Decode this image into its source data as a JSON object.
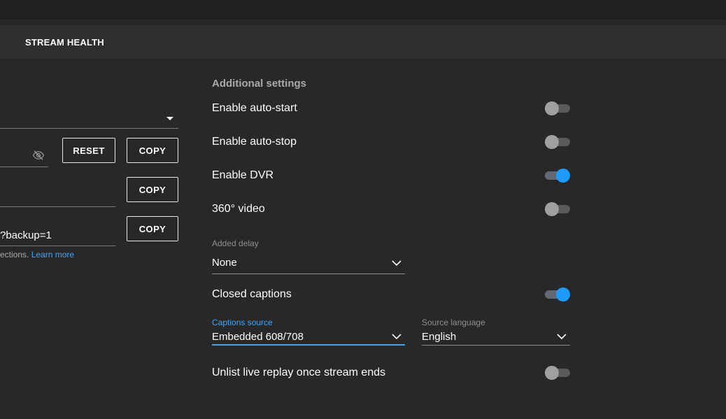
{
  "tabs": {
    "stream_health": "STREAM HEALTH"
  },
  "left_panel": {
    "reset_button": "RESET",
    "copy_button_1": "COPY",
    "copy_button_2": "COPY",
    "copy_button_3": "COPY",
    "backup_url_fragment": "?backup=1",
    "hint_text": "ections. ",
    "learn_more": "Learn more"
  },
  "settings": {
    "title": "Additional settings",
    "auto_start": {
      "label": "Enable auto-start",
      "on": false
    },
    "auto_stop": {
      "label": "Enable auto-stop",
      "on": false
    },
    "dvr": {
      "label": "Enable DVR",
      "on": true
    },
    "video_360": {
      "label": "360° video",
      "on": false
    },
    "added_delay": {
      "label": "Added delay",
      "value": "None"
    },
    "closed_captions": {
      "label": "Closed captions",
      "on": true
    },
    "captions_source": {
      "label": "Captions source",
      "value": "Embedded 608/708"
    },
    "source_language": {
      "label": "Source language",
      "value": "English"
    },
    "unlist_replay": {
      "label": "Unlist live replay once stream ends",
      "on": false
    }
  },
  "colors": {
    "accent": "#3ea6ff",
    "toggle_on": "#1e9bff",
    "background": "#282828"
  }
}
